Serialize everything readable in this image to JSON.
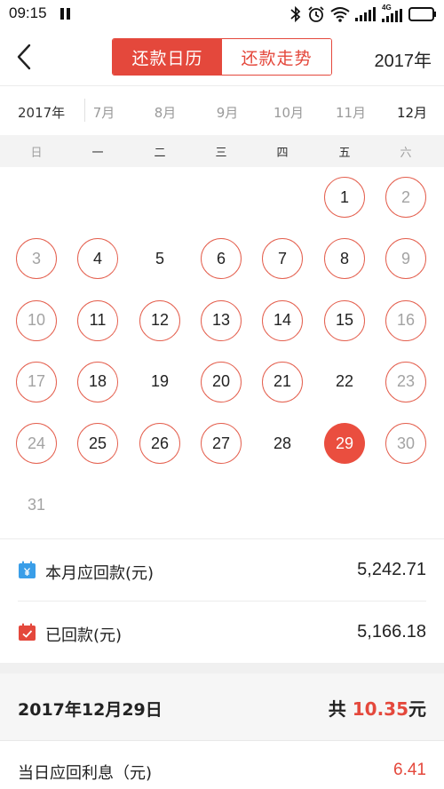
{
  "status_bar": {
    "time": "09:15",
    "network_label": "4G"
  },
  "header": {
    "tab_calendar": "还款日历",
    "tab_trend": "还款走势",
    "year": "2017年"
  },
  "month_strip": {
    "year": "2017年",
    "months": [
      "7月",
      "8月",
      "9月",
      "10月",
      "11月",
      "12月"
    ],
    "selected_index": 5
  },
  "weekdays": [
    "日",
    "一",
    "二",
    "三",
    "四",
    "五",
    "六"
  ],
  "calendar": {
    "days": [
      {
        "n": "1",
        "ring": true,
        "muted": false,
        "selected": false
      },
      {
        "n": "2",
        "ring": true,
        "muted": true,
        "selected": false
      },
      {
        "n": "3",
        "ring": true,
        "muted": true,
        "selected": false
      },
      {
        "n": "4",
        "ring": true,
        "muted": false,
        "selected": false
      },
      {
        "n": "5",
        "ring": false,
        "muted": false,
        "selected": false
      },
      {
        "n": "6",
        "ring": true,
        "muted": false,
        "selected": false
      },
      {
        "n": "7",
        "ring": true,
        "muted": false,
        "selected": false
      },
      {
        "n": "8",
        "ring": true,
        "muted": false,
        "selected": false
      },
      {
        "n": "9",
        "ring": true,
        "muted": true,
        "selected": false
      },
      {
        "n": "10",
        "ring": true,
        "muted": true,
        "selected": false
      },
      {
        "n": "11",
        "ring": true,
        "muted": false,
        "selected": false
      },
      {
        "n": "12",
        "ring": true,
        "muted": false,
        "selected": false
      },
      {
        "n": "13",
        "ring": true,
        "muted": false,
        "selected": false
      },
      {
        "n": "14",
        "ring": true,
        "muted": false,
        "selected": false
      },
      {
        "n": "15",
        "ring": true,
        "muted": false,
        "selected": false
      },
      {
        "n": "16",
        "ring": true,
        "muted": true,
        "selected": false
      },
      {
        "n": "17",
        "ring": true,
        "muted": true,
        "selected": false
      },
      {
        "n": "18",
        "ring": true,
        "muted": false,
        "selected": false
      },
      {
        "n": "19",
        "ring": false,
        "muted": false,
        "selected": false
      },
      {
        "n": "20",
        "ring": true,
        "muted": false,
        "selected": false
      },
      {
        "n": "21",
        "ring": true,
        "muted": false,
        "selected": false
      },
      {
        "n": "22",
        "ring": false,
        "muted": false,
        "selected": false
      },
      {
        "n": "23",
        "ring": true,
        "muted": true,
        "selected": false
      },
      {
        "n": "24",
        "ring": true,
        "muted": true,
        "selected": false
      },
      {
        "n": "25",
        "ring": true,
        "muted": false,
        "selected": false
      },
      {
        "n": "26",
        "ring": true,
        "muted": false,
        "selected": false
      },
      {
        "n": "27",
        "ring": true,
        "muted": false,
        "selected": false
      },
      {
        "n": "28",
        "ring": false,
        "muted": false,
        "selected": false
      },
      {
        "n": "29",
        "ring": false,
        "muted": false,
        "selected": true
      },
      {
        "n": "30",
        "ring": true,
        "muted": true,
        "selected": false
      },
      {
        "n": "31",
        "ring": false,
        "muted": true,
        "selected": false
      }
    ],
    "first_weekday": 5
  },
  "summary": {
    "due_label": "本月应回款(元)",
    "due_value": "5,242.71",
    "received_label": "已回款(元)",
    "received_value": "5,166.18"
  },
  "detail": {
    "date": "2017年12月29日",
    "total_prefix": "共 ",
    "total_amount": "10.35",
    "total_suffix": "元",
    "interest_label": "当日应回利息（元)",
    "interest_value": "6.41"
  },
  "colors": {
    "accent": "#e4483c",
    "blue_icon": "#3a9ee8"
  }
}
